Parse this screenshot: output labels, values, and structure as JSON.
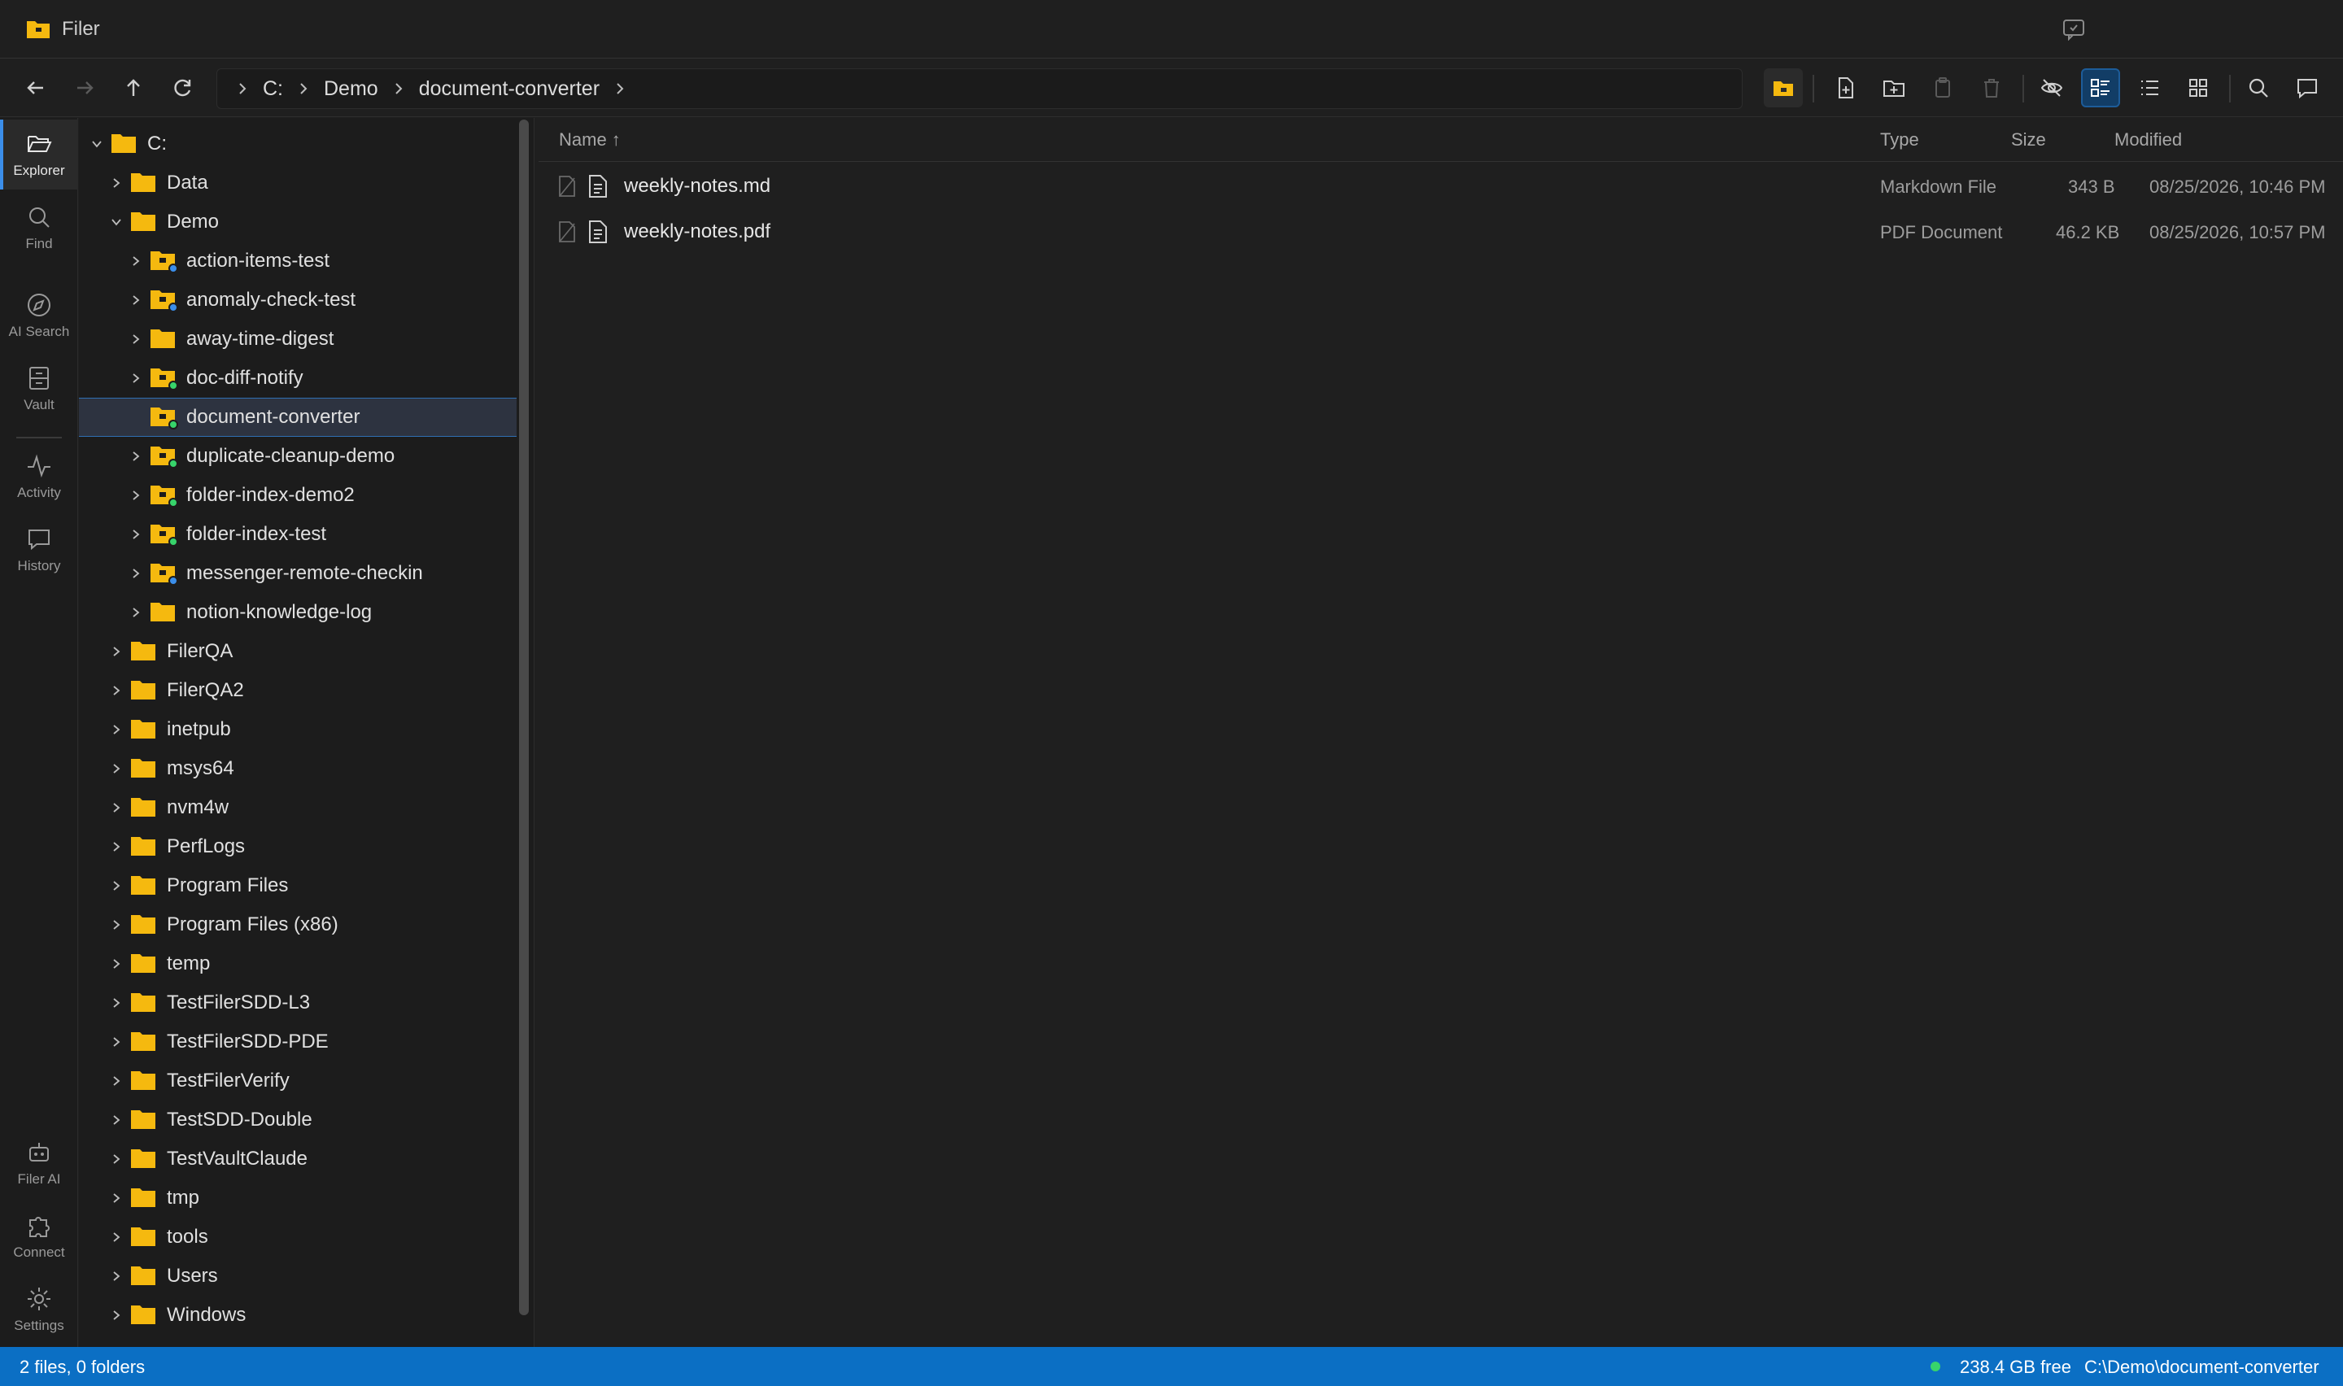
{
  "app": {
    "title": "Filer"
  },
  "breadcrumb": [
    "C:",
    "Demo",
    "document-converter"
  ],
  "activity": [
    {
      "label": "Explorer",
      "icon": "folder-open-icon"
    },
    {
      "label": "Find",
      "icon": "search-icon"
    },
    {
      "label": "AI Search",
      "icon": "compass-icon"
    },
    {
      "label": "Vault",
      "icon": "vault-icon"
    },
    {
      "label": "Activity",
      "icon": "pulse-icon"
    },
    {
      "label": "History",
      "icon": "chat-bubble-icon"
    },
    {
      "label": "Filer AI",
      "icon": "robot-icon"
    },
    {
      "label": "Connect",
      "icon": "puzzle-icon"
    },
    {
      "label": "Settings",
      "icon": "gear-icon"
    }
  ],
  "tree": [
    {
      "label": "C:",
      "depth": 0,
      "expanded": true
    },
    {
      "label": "Data",
      "depth": 1
    },
    {
      "label": "Demo",
      "depth": 1,
      "expanded": true
    },
    {
      "label": "action-items-test",
      "depth": 2,
      "badge": "blue"
    },
    {
      "label": "anomaly-check-test",
      "depth": 2,
      "badge": "blue"
    },
    {
      "label": "away-time-digest",
      "depth": 2
    },
    {
      "label": "doc-diff-notify",
      "depth": 2,
      "badge": "green"
    },
    {
      "label": "document-converter",
      "depth": 2,
      "badge": "green",
      "selected": true,
      "nochev": true
    },
    {
      "label": "duplicate-cleanup-demo",
      "depth": 2,
      "badge": "green"
    },
    {
      "label": "folder-index-demo2",
      "depth": 2,
      "badge": "green"
    },
    {
      "label": "folder-index-test",
      "depth": 2,
      "badge": "green"
    },
    {
      "label": "messenger-remote-checkin",
      "depth": 2,
      "badge": "blue"
    },
    {
      "label": "notion-knowledge-log",
      "depth": 2
    },
    {
      "label": "FilerQA",
      "depth": 1
    },
    {
      "label": "FilerQA2",
      "depth": 1
    },
    {
      "label": "inetpub",
      "depth": 1
    },
    {
      "label": "msys64",
      "depth": 1
    },
    {
      "label": "nvm4w",
      "depth": 1
    },
    {
      "label": "PerfLogs",
      "depth": 1
    },
    {
      "label": "Program Files",
      "depth": 1
    },
    {
      "label": "Program Files (x86)",
      "depth": 1
    },
    {
      "label": "temp",
      "depth": 1
    },
    {
      "label": "TestFilerSDD-L3",
      "depth": 1
    },
    {
      "label": "TestFilerSDD-PDE",
      "depth": 1
    },
    {
      "label": "TestFilerVerify",
      "depth": 1
    },
    {
      "label": "TestSDD-Double",
      "depth": 1
    },
    {
      "label": "TestVaultClaude",
      "depth": 1
    },
    {
      "label": "tmp",
      "depth": 1
    },
    {
      "label": "tools",
      "depth": 1
    },
    {
      "label": "Users",
      "depth": 1
    },
    {
      "label": "Windows",
      "depth": 1
    }
  ],
  "columns": {
    "name": "Name ↑",
    "type": "Type",
    "size": "Size",
    "modified": "Modified"
  },
  "files": [
    {
      "name": "weekly-notes.md",
      "type": "Markdown File",
      "size": "343 B",
      "modified": "08/25/2026, 10:46 PM"
    },
    {
      "name": "weekly-notes.pdf",
      "type": "PDF Document",
      "size": "46.2 KB",
      "modified": "08/25/2026, 10:57 PM"
    }
  ],
  "status": {
    "summary": "2 files, 0 folders",
    "free": "238.4 GB free",
    "path": "C:\\Demo\\document-converter"
  },
  "colors": {
    "accent": "#0b6fc4",
    "folder": "#f5b90f",
    "badge_blue": "#3b8eea",
    "badge_green": "#37d46b"
  }
}
